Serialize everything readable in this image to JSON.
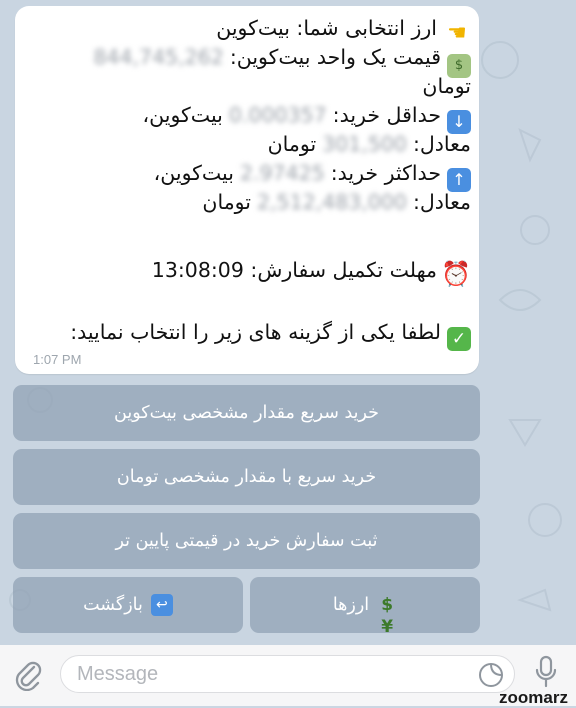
{
  "message": {
    "line1": "ارز انتخابی شما: بیت‌کوین",
    "line2_label": "قیمت یک واحد بیت‌کوین:",
    "line2_value": "844,745,262",
    "line3": "تومان",
    "line4_label": "حداقل خرید:",
    "line4_value": "0.000357",
    "line4_unit": "بیت‌کوین،",
    "line5_label": "معادل:",
    "line5_value": "301,500",
    "line5_unit": "تومان",
    "line6_label": "حداکثر خرید:",
    "line6_value": "2.97425",
    "line6_unit": "بیت‌کوین،",
    "line7_label": "معادل:",
    "line7_value": "2,512,483,000",
    "line7_unit": "تومان",
    "deadline_label": "مهلت تکمیل سفارش:",
    "deadline_value": "13:08:09",
    "prompt": "لطفا یکی از گزینه های زیر را انتخاب نمایید:",
    "time": "1:07 PM"
  },
  "keyboard": {
    "btn1": "خرید سریع مقدار مشخصی بیت‌کوین",
    "btn2": "خرید سریع با مقدار مشخصی تومان",
    "btn3": "ثبت سفارش خرید در قیمتی پایین تر",
    "btn_currencies": "ارزها",
    "btn_back": "بازگشت"
  },
  "input": {
    "placeholder": "Message"
  },
  "watermark": "zoomarz",
  "icons": {
    "hand": "pointing-hand-icon",
    "money": "dollar-bill-icon",
    "down": "down-arrow-icon",
    "up": "up-arrow-icon",
    "clock": "alarm-clock-icon",
    "check": "check-mark-icon",
    "attach": "paperclip-icon",
    "sticker": "sticker-icon",
    "mic": "microphone-icon",
    "back": "back-arrow-icon",
    "currencies": "currency-exchange-icon"
  }
}
